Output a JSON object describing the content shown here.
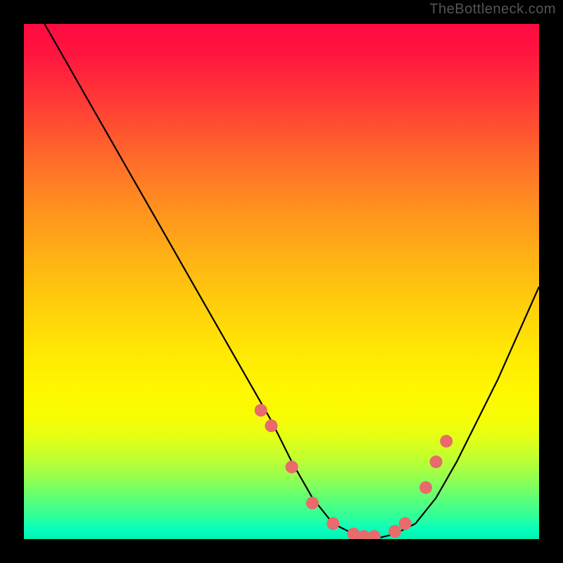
{
  "watermark": "TheBottleneck.com",
  "colors": {
    "dot": "#e86a6a",
    "curve": "#000000",
    "frame": "#000000"
  },
  "chart_data": {
    "type": "line",
    "title": "",
    "xlabel": "",
    "ylabel": "",
    "xlim": [
      0,
      100
    ],
    "ylim": [
      0,
      100
    ],
    "grid": false,
    "legend": false,
    "series": [
      {
        "name": "bottleneck-curve",
        "x": [
          4,
          8,
          12,
          16,
          20,
          24,
          28,
          32,
          36,
          40,
          44,
          48,
          52,
          56,
          60,
          64,
          68,
          72,
          76,
          80,
          84,
          88,
          92,
          96,
          100
        ],
        "y": [
          100,
          93,
          86,
          79,
          72,
          65,
          58,
          51,
          44,
          37,
          30,
          23,
          15,
          8,
          3,
          1,
          0,
          1,
          3,
          8,
          15,
          23,
          31,
          40,
          49
        ]
      }
    ],
    "markers": {
      "name": "highlighted-points",
      "x": [
        46,
        48,
        52,
        56,
        60,
        64,
        66,
        68,
        72,
        74,
        78,
        80,
        82
      ],
      "y": [
        25,
        22,
        14,
        7,
        3,
        1,
        0.5,
        0.5,
        1.5,
        3,
        10,
        15,
        19
      ]
    }
  }
}
